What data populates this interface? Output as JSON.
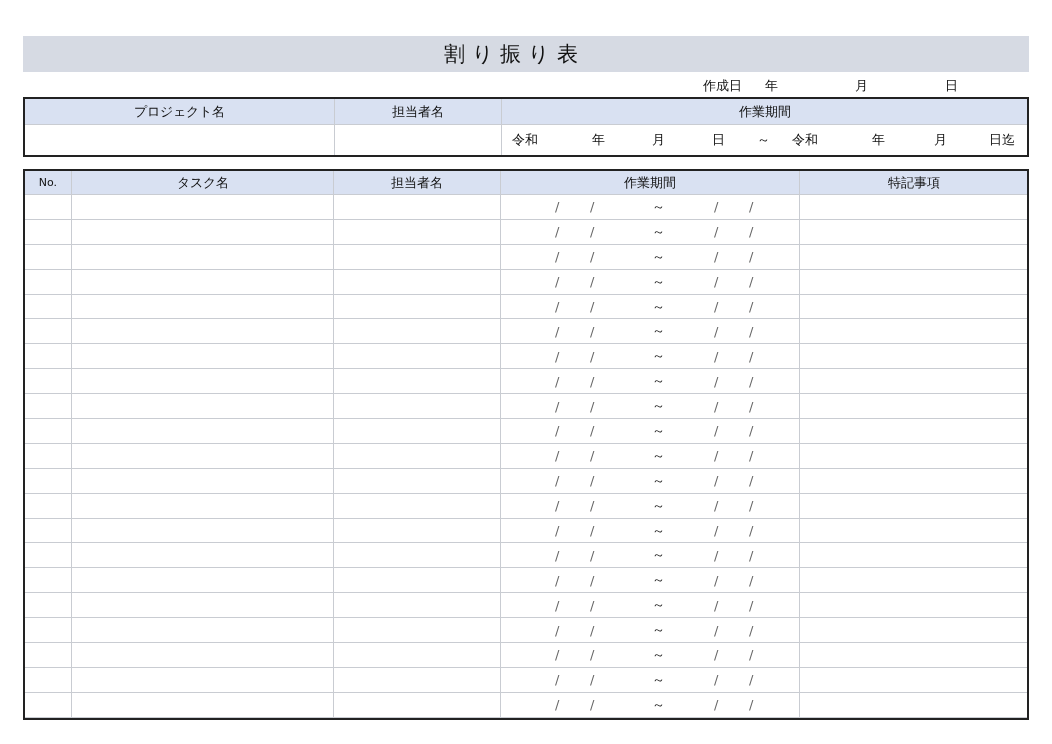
{
  "title": "割 り 振 り 表",
  "created": {
    "label": "作成日",
    "year": "年",
    "month": "月",
    "day": "日"
  },
  "project_table": {
    "columns": [
      "プロジェクト名",
      "担当者名",
      "作業期間"
    ],
    "period": [
      "令和",
      "年",
      "月",
      "日",
      "～",
      "令和",
      "年",
      "月",
      "日迄"
    ]
  },
  "task_table": {
    "columns": [
      "No.",
      "タスク名",
      "担当者名",
      "作業期間",
      "特記事項"
    ],
    "rows": [
      {
        "period": [
          "/",
          "/",
          "～",
          "/",
          "/"
        ]
      },
      {
        "period": [
          "/",
          "/",
          "～",
          "/",
          "/"
        ]
      },
      {
        "period": [
          "/",
          "/",
          "～",
          "/",
          "/"
        ]
      },
      {
        "period": [
          "/",
          "/",
          "～",
          "/",
          "/"
        ]
      },
      {
        "period": [
          "/",
          "/",
          "～",
          "/",
          "/"
        ]
      },
      {
        "period": [
          "/",
          "/",
          "～",
          "/",
          "/"
        ]
      },
      {
        "period": [
          "/",
          "/",
          "～",
          "/",
          "/"
        ]
      },
      {
        "period": [
          "/",
          "/",
          "～",
          "/",
          "/"
        ]
      },
      {
        "period": [
          "/",
          "/",
          "～",
          "/",
          "/"
        ]
      },
      {
        "period": [
          "/",
          "/",
          "～",
          "/",
          "/"
        ]
      },
      {
        "period": [
          "/",
          "/",
          "～",
          "/",
          "/"
        ]
      },
      {
        "period": [
          "/",
          "/",
          "～",
          "/",
          "/"
        ]
      },
      {
        "period": [
          "/",
          "/",
          "～",
          "/",
          "/"
        ]
      },
      {
        "period": [
          "/",
          "/",
          "～",
          "/",
          "/"
        ]
      },
      {
        "period": [
          "/",
          "/",
          "～",
          "/",
          "/"
        ]
      },
      {
        "period": [
          "/",
          "/",
          "～",
          "/",
          "/"
        ]
      },
      {
        "period": [
          "/",
          "/",
          "～",
          "/",
          "/"
        ]
      },
      {
        "period": [
          "/",
          "/",
          "～",
          "/",
          "/"
        ]
      },
      {
        "period": [
          "/",
          "/",
          "～",
          "/",
          "/"
        ]
      },
      {
        "period": [
          "/",
          "/",
          "～",
          "/",
          "/"
        ]
      },
      {
        "period": [
          "/",
          "/",
          "～",
          "/",
          "/"
        ]
      }
    ]
  }
}
